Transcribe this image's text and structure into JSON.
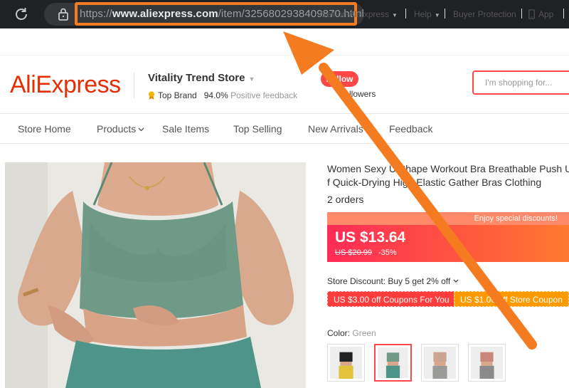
{
  "browser": {
    "url_prefix": "https://",
    "url_domain": "www.aliexpress.com",
    "url_path": "/item/3256802938409870.html",
    "reload_icon": "reload-icon",
    "lock_icon": "lock-icon"
  },
  "util_bar": {
    "sell": "Sell on AliExpress",
    "help": "Help",
    "buyer_protection": "Buyer Protection",
    "app": "App"
  },
  "store": {
    "logo": "AliExpress",
    "name": "Vitality Trend Store",
    "badge": "Top Brand",
    "feedback_value": "94.0%",
    "feedback_label": "Positive feedback",
    "follow": "Follow",
    "followers": "Followers",
    "search_placeholder": "I'm shopping for..."
  },
  "nav": {
    "items": [
      "Store Home",
      "Products",
      "Sale Items",
      "Top Selling",
      "New Arrivals",
      "Feedback"
    ]
  },
  "product": {
    "title_line1": "Women Sexy U Shape Workout Bra Breathable Push Up",
    "title_line2": "f Quick-Drying High Elastic Gather Bras Clothing",
    "orders": "2 orders",
    "promo": "Enjoy special discounts!",
    "price": "US $13.64",
    "original_price": "US $20.99",
    "discount": "-35%",
    "store_discount": "Store Discount: Buy 5 get 2% off",
    "coupons": [
      "US $3.00 off Coupons For You",
      "US $1.00 off Store Coupon"
    ],
    "color_label": "Color:",
    "color_value": "Green"
  },
  "colors": {
    "accent": "#ff4747",
    "brand": "#e62e04",
    "annotation_arrow": "#f47b20"
  }
}
